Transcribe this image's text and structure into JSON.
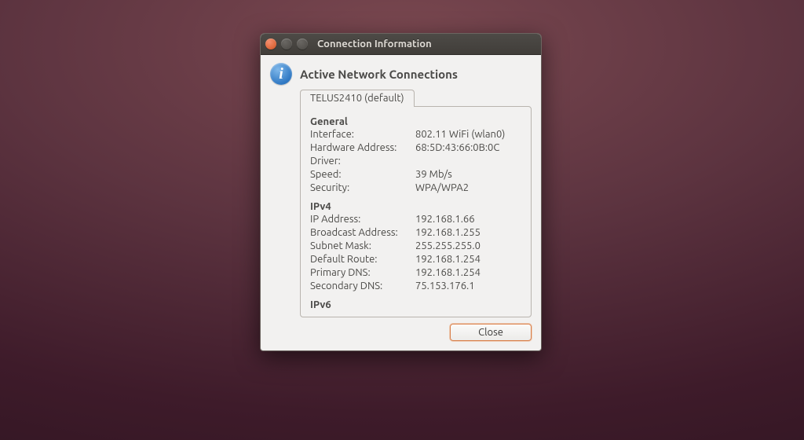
{
  "window": {
    "title": "Connection Information"
  },
  "dialog": {
    "heading": "Active Network Connections",
    "tab_label": "TELUS2410 (default)",
    "close_button": "Close"
  },
  "sections": {
    "general": {
      "title": "General",
      "interface_lbl": "Interface:",
      "interface_val": "802.11 WiFi (wlan0)",
      "hwaddr_lbl": "Hardware Address:",
      "hwaddr_val": "68:5D:43:66:0B:0C",
      "driver_lbl": "Driver:",
      "driver_val": "",
      "speed_lbl": "Speed:",
      "speed_val": "39 Mb/s",
      "security_lbl": "Security:",
      "security_val": "WPA/WPA2"
    },
    "ipv4": {
      "title": "IPv4",
      "ip_lbl": "IP Address:",
      "ip_val": "192.168.1.66",
      "bcast_lbl": "Broadcast Address:",
      "bcast_val": "192.168.1.255",
      "mask_lbl": "Subnet Mask:",
      "mask_val": "255.255.255.0",
      "route_lbl": "Default Route:",
      "route_val": "192.168.1.254",
      "pdns_lbl": "Primary DNS:",
      "pdns_val": "192.168.1.254",
      "sdns_lbl": "Secondary DNS:",
      "sdns_val": "75.153.176.1"
    },
    "ipv6": {
      "title": "IPv6"
    }
  }
}
